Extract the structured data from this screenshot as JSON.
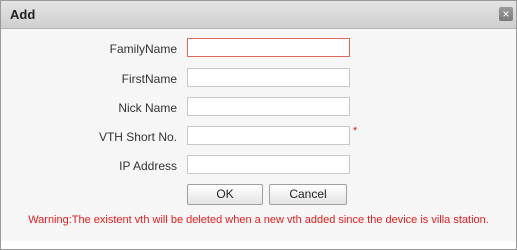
{
  "dialog": {
    "title": "Add",
    "close_glyph": "×"
  },
  "form": {
    "fields": [
      {
        "label": "FamilyName",
        "value": "",
        "required": false
      },
      {
        "label": "FirstName",
        "value": "",
        "required": false
      },
      {
        "label": "Nick Name",
        "value": "",
        "required": false
      },
      {
        "label": "VTH Short No.",
        "value": "",
        "required": true,
        "required_mark": "*"
      },
      {
        "label": "IP Address",
        "value": "",
        "required": false
      }
    ]
  },
  "buttons": {
    "ok_label": "OK",
    "cancel_label": "Cancel"
  },
  "warning": "Warning:The existent vth will be deleted when a new vth added since the device is villa station.",
  "colors": {
    "warning_text": "#e31d1d",
    "active_border": "#e06a5a",
    "titlebar": "#d8d8d8"
  }
}
